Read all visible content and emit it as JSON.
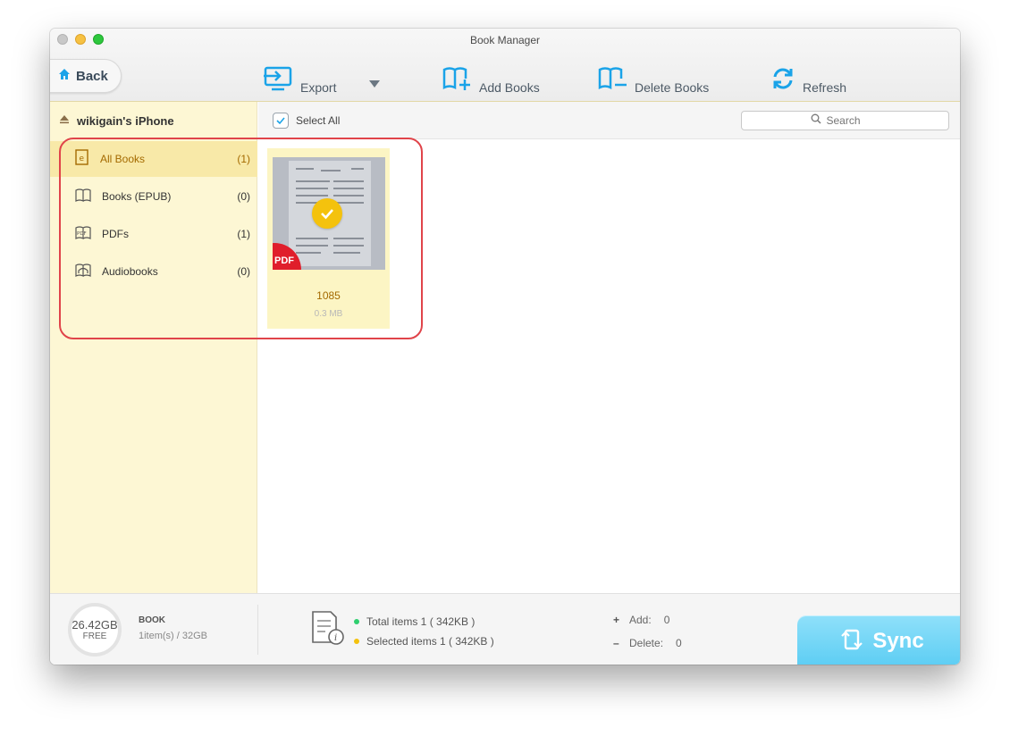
{
  "window": {
    "title": "Book Manager"
  },
  "toolbar": {
    "back_label": "Back",
    "export_label": "Export",
    "add_books_label": "Add Books",
    "delete_books_label": "Delete Books",
    "refresh_label": "Refresh"
  },
  "sidebar": {
    "device_name": "wikigain's iPhone",
    "categories": [
      {
        "label": "All Books",
        "count": "(1)",
        "icon": "all-books-icon",
        "selected": true
      },
      {
        "label": "Books (EPUB)",
        "count": "(0)",
        "icon": "book-open-icon",
        "selected": false
      },
      {
        "label": "PDFs",
        "count": "(1)",
        "icon": "pdf-icon",
        "selected": false
      },
      {
        "label": "Audiobooks",
        "count": "(0)",
        "icon": "headphones-icon",
        "selected": false
      }
    ]
  },
  "content": {
    "select_all_label": "Select All",
    "search_placeholder": "Search",
    "books": [
      {
        "name": "1085",
        "size": "0.3 MB",
        "badge": "PDF",
        "checked": true
      }
    ]
  },
  "footer": {
    "free_space": "26.42GB",
    "free_label": "FREE",
    "storage_type": "BOOK",
    "storage_summary": "1item(s) / 32GB",
    "total_items": "Total items 1 ( 342KB )",
    "selected_items": "Selected items 1 ( 342KB )",
    "add_label": "Add:",
    "add_value": "0",
    "delete_label": "Delete:",
    "delete_value": "0",
    "sync_label": "Sync"
  },
  "colors": {
    "accent": "#1aa3e8",
    "sidebar_bg": "#fdf7d4",
    "selected_text": "#a46a00",
    "sync_button": "#5ccdf3",
    "highlight_box": "#e0444a",
    "pdf_badge": "#e01e2b",
    "check_badge": "#f4c20d"
  }
}
